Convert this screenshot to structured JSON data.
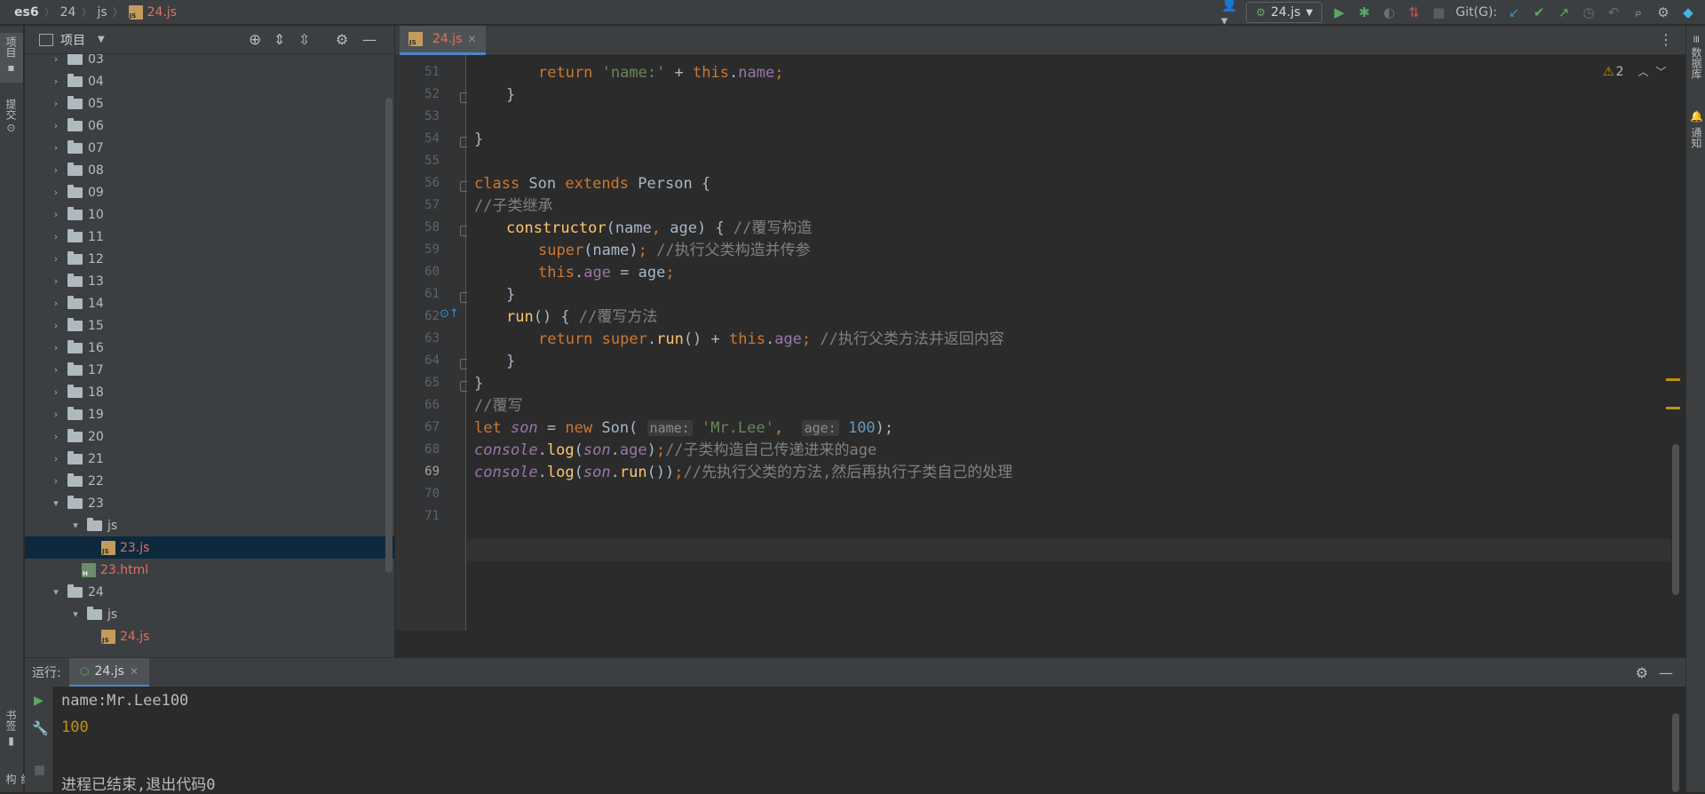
{
  "breadcrumb": {
    "project": "es6",
    "folder": "24",
    "subfolder": "js",
    "file": "24.js"
  },
  "toolbar": {
    "run_config": "24.js",
    "git_label": "Git(G):"
  },
  "left_strip": {
    "project_tab": "项目",
    "commit_tab": "提交",
    "bookmarks_tab": "书签",
    "structure_tab": "结构"
  },
  "right_strip": {
    "database_tab": "数据库",
    "notifications_tab": "通知"
  },
  "project_panel": {
    "title": "项目",
    "folders": [
      "03",
      "04",
      "05",
      "06",
      "07",
      "08",
      "09",
      "10",
      "11",
      "12",
      "13",
      "14",
      "15",
      "16",
      "17",
      "18",
      "19",
      "20",
      "21",
      "22",
      "23"
    ],
    "folder23_sub": "js",
    "file_23js": "23.js",
    "file_23html": "23.html",
    "folder24": "24",
    "folder24_sub": "js",
    "file_24js": "24.js"
  },
  "editor": {
    "tab_label": "24.js",
    "warnings_count": "2",
    "line_numbers": [
      "51",
      "52",
      "53",
      "54",
      "55",
      "56",
      "57",
      "58",
      "59",
      "60",
      "61",
      "62",
      "63",
      "64",
      "65",
      "66",
      "67",
      "68",
      "69",
      "70",
      "71"
    ],
    "current_line": "69",
    "code": {
      "l51_ret": "return ",
      "l51_str": "'name:'",
      "l51_plus": " + ",
      "l51_this": "this",
      "l51_dot": ".",
      "l51_prop": "name",
      "l51_end": ";",
      "l52": "}",
      "l54": "}",
      "l56_kw1": "class ",
      "l56_name": "Son ",
      "l56_kw2": "extends ",
      "l56_rest": "Person {",
      "l57": "//子类继承",
      "l58_fn": "constructor",
      "l58_args": "(name",
      "l58_comma": ", ",
      "l58_args2": "age) { ",
      "l58_cm": "//覆写构造",
      "l59_kw": "super",
      "l59_args": "(name)",
      "l59_semi": "; ",
      "l59_cm": "//执行父类构造并传参",
      "l60_this": "this",
      "l60_dot": ".",
      "l60_prop": "age",
      "l60_rest": " = age",
      "l60_semi": ";",
      "l61": "}",
      "l62_fn": "run",
      "l62_rest": "() { ",
      "l62_cm": "//覆写方法",
      "l63_ret": "return ",
      "l63_super": "super",
      "l63_dot": ".",
      "l63_run": "run",
      "l63_rest": "() + ",
      "l63_this": "this",
      "l63_dot2": ".",
      "l63_prop": "age",
      "l63_semi": "; ",
      "l63_cm": "//执行父类方法并返回内容",
      "l64": "}",
      "l65": "}",
      "l66": "//覆写",
      "l67_let": "let ",
      "l67_var": "son",
      "l67_eq": " = ",
      "l67_new": "new ",
      "l67_cls": "Son(",
      "l67_hint1": "name:",
      "l67_str": "'Mr.Lee'",
      "l67_comma": ", ",
      "l67_hint2": "age:",
      "l67_num": "100",
      "l67_end": ");",
      "l68_console": "console",
      "l68_dot": ".",
      "l68_log": "log",
      "l68_open": "(",
      "l68_son": "son",
      "l68_dot2": ".",
      "l68_age": "age",
      "l68_close": ")",
      "l68_semi": ";",
      "l68_cm": "//子类构造自己传递进来的age",
      "l69_console": "console",
      "l69_dot": ".",
      "l69_log": "log",
      "l69_open": "(",
      "l69_son": "son",
      "l69_dot2": ".",
      "l69_run": "run",
      "l69_close": "())",
      "l69_semi": ";",
      "l69_cm": "//先执行父类的方法,然后再执行子类自己的处理"
    }
  },
  "run_panel": {
    "label": "运行:",
    "tab_label": "24.js",
    "output": [
      "name:Mr.Lee100",
      "100",
      "",
      "进程已结束,退出代码0"
    ]
  },
  "colors": {
    "accent": "#4a88c7",
    "warning": "#be9117",
    "run_green": "#59a869",
    "file_red": "#e0715f"
  }
}
